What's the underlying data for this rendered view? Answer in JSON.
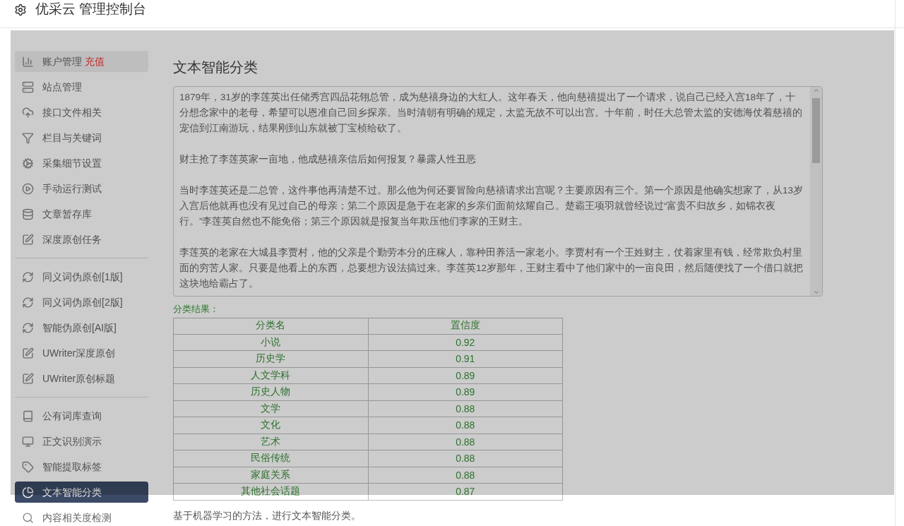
{
  "header": {
    "title": "优采云 管理控制台"
  },
  "dimmed": true,
  "sidebar": {
    "groups": [
      {
        "items": [
          {
            "label": "账户管理",
            "badge": "充值",
            "selected": false,
            "hovered": true
          },
          {
            "label": "站点管理",
            "selected": false,
            "hovered": false
          },
          {
            "label": "接口文件相关",
            "selected": false,
            "hovered": false
          },
          {
            "label": "栏目与关键词",
            "selected": false,
            "hovered": false
          },
          {
            "label": "采集细节设置",
            "selected": false,
            "hovered": false
          },
          {
            "label": "手动运行测试",
            "selected": false,
            "hovered": false
          },
          {
            "label": "文章暂存库",
            "selected": false,
            "hovered": false
          },
          {
            "label": "深度原创任务",
            "selected": false,
            "hovered": false
          }
        ]
      },
      {
        "items": [
          {
            "label": "同义词伪原创[1版]",
            "selected": false,
            "hovered": false
          },
          {
            "label": "同义词伪原创[2版]",
            "selected": false,
            "hovered": false
          },
          {
            "label": "智能伪原创[AI版]",
            "selected": false,
            "hovered": false
          },
          {
            "label": "UWriter深度原创",
            "selected": false,
            "hovered": false
          },
          {
            "label": "UWriter原创标题",
            "selected": false,
            "hovered": false
          }
        ]
      },
      {
        "items": [
          {
            "label": "公有词库查询",
            "selected": false,
            "hovered": false
          },
          {
            "label": "正文识别演示",
            "selected": false,
            "hovered": false
          },
          {
            "label": "智能提取标签",
            "selected": false,
            "hovered": false
          },
          {
            "label": "文本智能分类",
            "selected": true,
            "hovered": false
          },
          {
            "label": "内容相关度检测",
            "selected": false,
            "hovered": false
          }
        ]
      }
    ]
  },
  "main": {
    "title": "文本智能分类",
    "text_area": {
      "paragraphs": [
        "1879年，31岁的李莲英出任储秀宫四品花翎总管，成为慈禧身边的大红人。这年春天，他向慈禧提出了一个请求，说自己已经入宫18年了，十分想念家中的老母，希望可以恩准自己回乡探亲。当时清朝有明确的规定，太监无故不可以出宫。十年前，时任大总管太监的安德海仗着慈禧的宠信到江南游玩，结果刚到山东就被丁宝桢给砍了。",
        "财主抢了李莲英家一亩地，他成慈禧亲信后如何报复？暴露人性丑恶",
        "当时李莲英还是二总管，这件事他再清楚不过。那么他为何还要冒险向慈禧请求出宫呢？主要原因有三个。第一个原因是他确实想家了，从13岁入宫后他就再也没有见过自己的母亲；第二个原因是急于在老家的乡亲们面前炫耀自己。楚霸王项羽就曾经说过“富贵不归故乡，如锦衣夜行。”李莲英自然也不能免俗；第三个原因就是报复当年欺压他们李家的王财主。",
        "李莲英的老家在大城县李贾村，他的父亲是个勤劳本分的庄稼人，靠种田养活一家老小。李贾村有一个王姓财主，仗着家里有钱，经常欺负村里面的穷苦人家。只要是他看上的东西，总要想方设法搞过来。李莲英12岁那年，王财主看中了他们家中的一亩良田，然后随便找了一个借口就把这块地给霸占了。"
      ]
    },
    "result_label": "分类结果：",
    "table": {
      "columns": [
        "分类名",
        "置信度"
      ],
      "rows": [
        [
          "小说",
          "0.92"
        ],
        [
          "历史学",
          "0.91"
        ],
        [
          "人文学科",
          "0.89"
        ],
        [
          "历史人物",
          "0.89"
        ],
        [
          "文学",
          "0.88"
        ],
        [
          "文化",
          "0.88"
        ],
        [
          "艺术",
          "0.88"
        ],
        [
          "民俗传统",
          "0.88"
        ],
        [
          "家庭关系",
          "0.88"
        ],
        [
          "其他社会话题",
          "0.87"
        ]
      ]
    },
    "note": "基于机器学习的方法，进行文本智能分类。"
  }
}
